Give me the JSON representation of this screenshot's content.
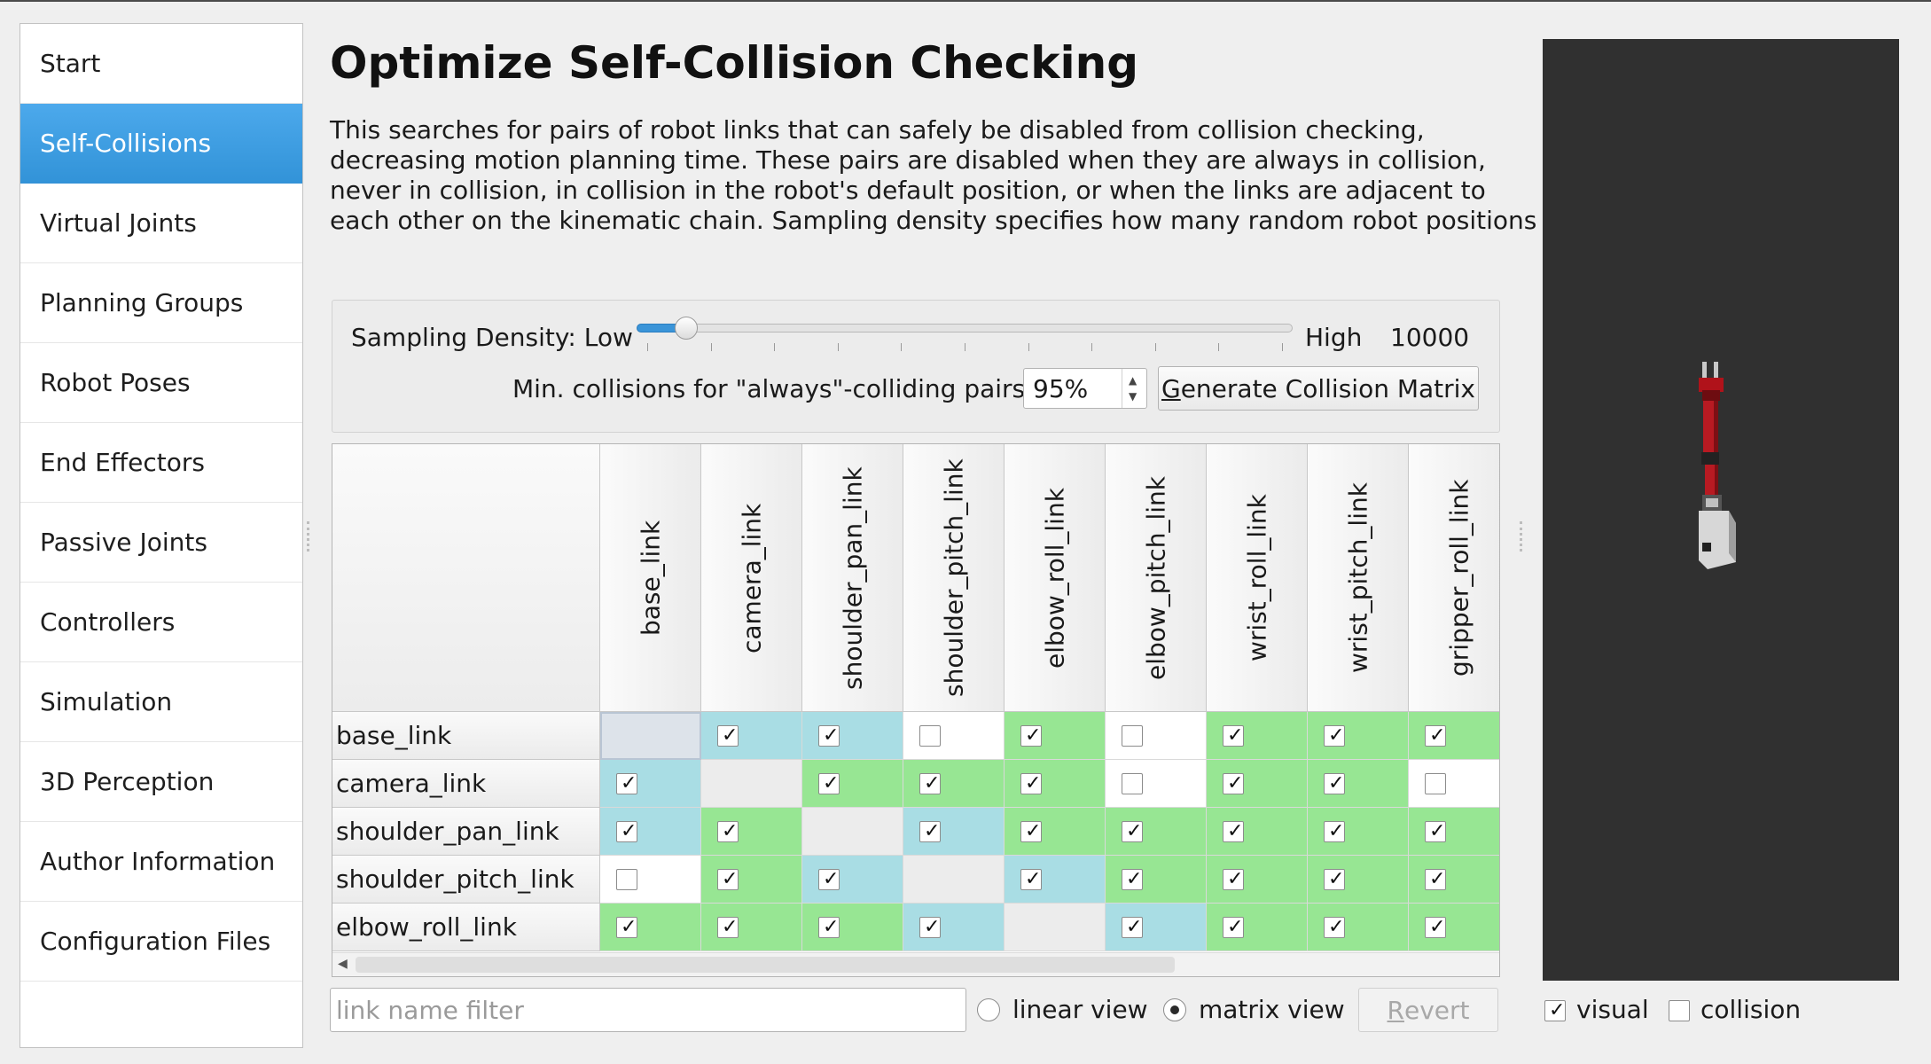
{
  "sidebar": {
    "items": [
      {
        "label": "Start",
        "active": false
      },
      {
        "label": "Self-Collisions",
        "active": true
      },
      {
        "label": "Virtual Joints",
        "active": false
      },
      {
        "label": "Planning Groups",
        "active": false
      },
      {
        "label": "Robot Poses",
        "active": false
      },
      {
        "label": "End Effectors",
        "active": false
      },
      {
        "label": "Passive Joints",
        "active": false
      },
      {
        "label": "Controllers",
        "active": false
      },
      {
        "label": "Simulation",
        "active": false
      },
      {
        "label": "3D Perception",
        "active": false
      },
      {
        "label": "Author Information",
        "active": false
      },
      {
        "label": "Configuration Files",
        "active": false
      }
    ]
  },
  "header": {
    "title": "Optimize Self-Collision Checking",
    "description_lines": [
      "This searches for pairs of robot links that can safely be disabled from collision checking,",
      "decreasing motion planning time. These pairs are disabled when they are always in collision,",
      "never in collision, in collision in the robot's default position, or when the links are adjacent to",
      "each other on the kinematic chain. Sampling density specifies how many random robot positions"
    ]
  },
  "settings": {
    "sampling_label": "Sampling Density: Low",
    "high_label": "High",
    "density_value": "10000",
    "slider_fraction": 0.075,
    "min_collisions_label": "Min. collisions for \"always\"-colliding pairs:",
    "min_collisions_value": "95%",
    "generate_button": {
      "mnemonic": "G",
      "rest": "enerate Collision Matrix"
    }
  },
  "matrix": {
    "columns": [
      "base_link",
      "camera_link",
      "shoulder_pan_link",
      "shoulder_pitch_link",
      "elbow_roll_link",
      "elbow_pitch_link",
      "wrist_roll_link",
      "wrist_pitch_link",
      "gripper_roll_link"
    ],
    "rows": [
      {
        "label": "base_link",
        "cells": [
          "s",
          "b1",
          "b1",
          "w0",
          "g1",
          "w0",
          "g1",
          "g1",
          "g1"
        ]
      },
      {
        "label": "camera_link",
        "cells": [
          "b1",
          "e",
          "g1",
          "g1",
          "g1",
          "w0",
          "g1",
          "g1",
          "w0"
        ]
      },
      {
        "label": "shoulder_pan_link",
        "cells": [
          "b1",
          "g1",
          "e",
          "b1",
          "g1",
          "g1",
          "g1",
          "g1",
          "g1"
        ]
      },
      {
        "label": "shoulder_pitch_link",
        "cells": [
          "w0",
          "g1",
          "b1",
          "e",
          "b1",
          "g1",
          "g1",
          "g1",
          "g1"
        ]
      },
      {
        "label": "elbow_roll_link",
        "cells": [
          "g1",
          "g1",
          "g1",
          "b1",
          "e",
          "b1",
          "g1",
          "g1",
          "g1"
        ]
      }
    ],
    "cell_legend": {
      "g": "#97e693",
      "b": "#a9dde4",
      "w": "#ffffff",
      "e": "#ececec"
    }
  },
  "bottom": {
    "filter_placeholder": "link name filter",
    "linear_view_label": "linear view",
    "matrix_view_label": "matrix view",
    "selected_view": "matrix",
    "revert_button": {
      "mnemonic": "R",
      "rest": "evert"
    }
  },
  "viewer": {
    "visual_label": "visual",
    "visual_checked": true,
    "collision_label": "collision",
    "collision_checked": false
  },
  "icons": {
    "check": "✓"
  }
}
